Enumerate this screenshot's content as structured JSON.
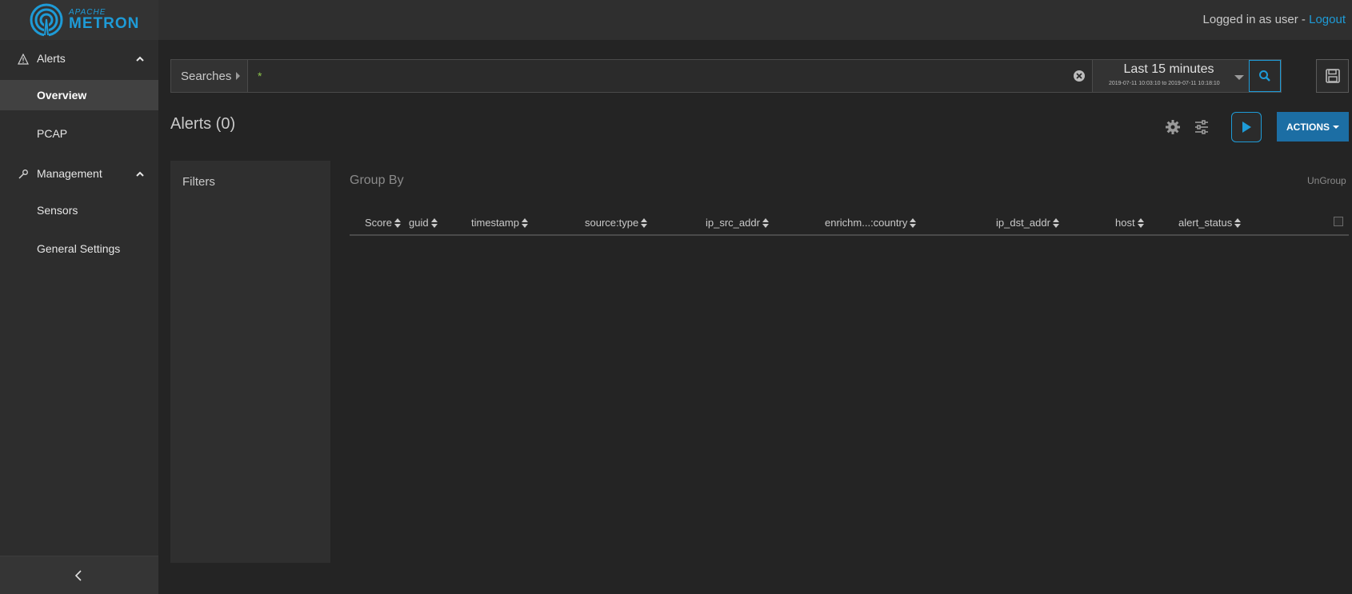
{
  "brand": {
    "small": "APACHE",
    "big": "METRON"
  },
  "header": {
    "login_prefix": "Logged in as user - ",
    "logout": "Logout"
  },
  "sidebar": {
    "sections": [
      {
        "label": "Alerts",
        "items": [
          {
            "label": "Overview",
            "active": true
          },
          {
            "label": "PCAP",
            "active": false
          }
        ]
      },
      {
        "label": "Management",
        "items": [
          {
            "label": "Sensors",
            "active": false
          },
          {
            "label": "General Settings",
            "active": false
          }
        ]
      }
    ]
  },
  "search": {
    "saved_label": "Searches",
    "query": "*",
    "time_range_title": "Last 15 minutes",
    "time_range_detail": "2019-07-11 10:03:10 to 2019-07-11 10:18:10"
  },
  "alerts": {
    "title": "Alerts (0)",
    "actions_label": "ACTIONS"
  },
  "filters": {
    "title": "Filters"
  },
  "group_by": {
    "title": "Group By",
    "ungroup_label": "UnGroup"
  },
  "table": {
    "columns": [
      "Score",
      "guid",
      "timestamp",
      "source:type",
      "ip_src_addr",
      "enrichm...:country",
      "ip_dst_addr",
      "host",
      "alert_status"
    ],
    "rows": []
  },
  "colors": {
    "accent": "#1e9bd7",
    "actions_bg": "#1c6ea4",
    "sidebar_bg": "#2d2d2d",
    "page_bg": "#242424"
  }
}
